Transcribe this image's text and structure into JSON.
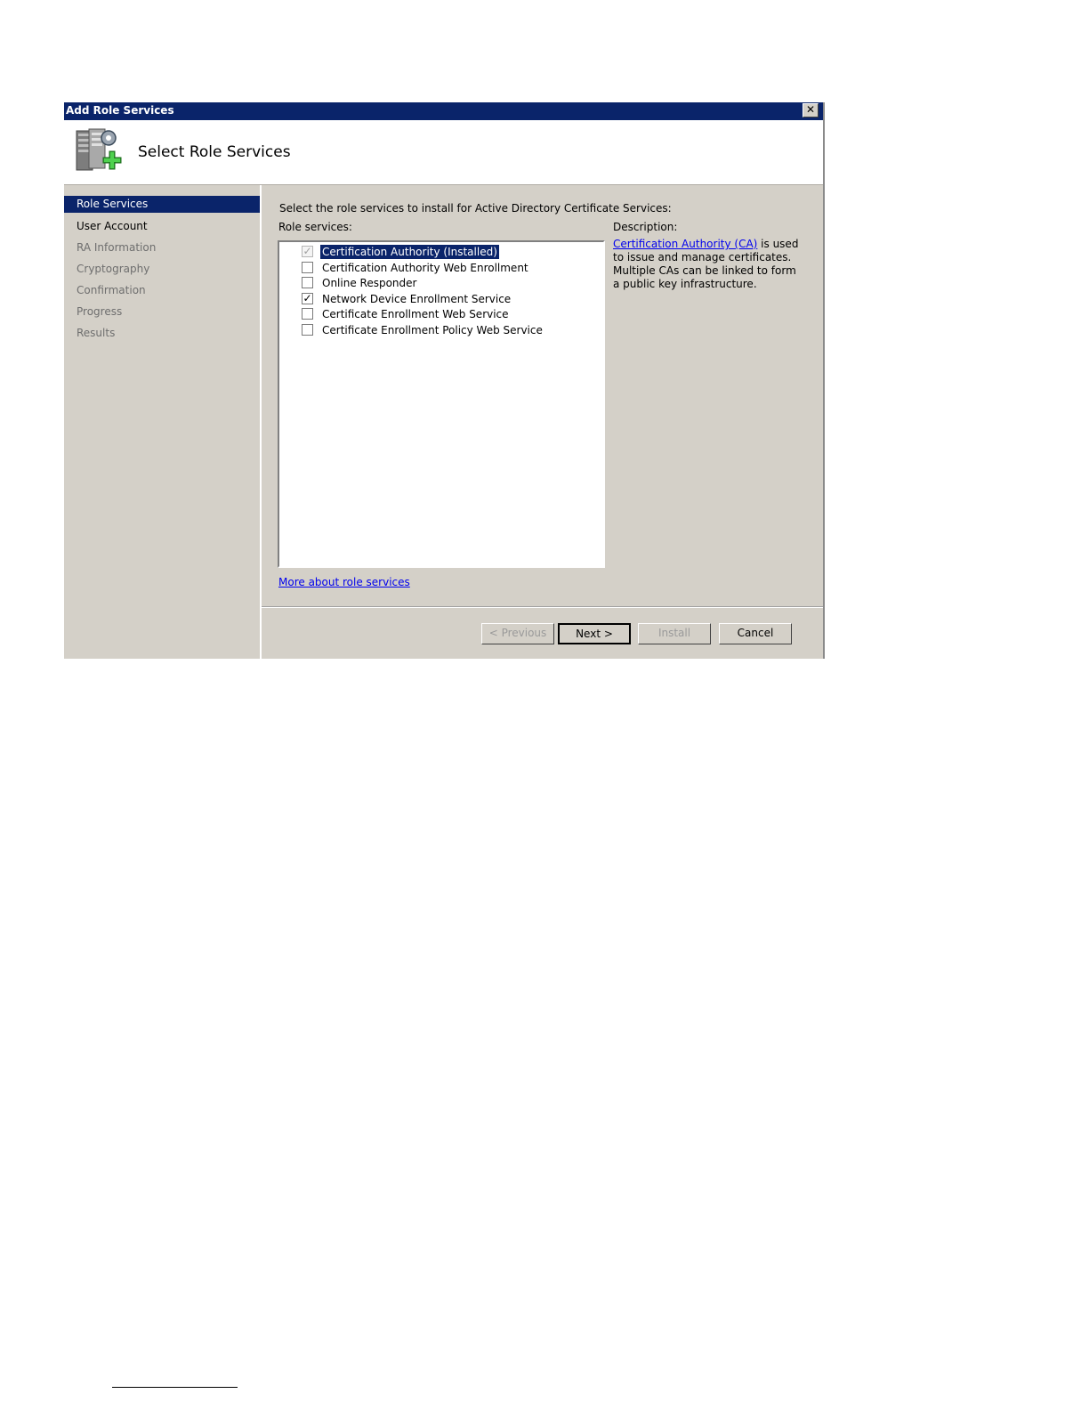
{
  "window": {
    "title": "Add Role Services",
    "close_glyph": "✕"
  },
  "header": {
    "title": "Select Role Services",
    "icon": "server-add-icon"
  },
  "nav": {
    "items": [
      {
        "label": "Role Services",
        "state": "active"
      },
      {
        "label": "User Account",
        "state": "normal"
      },
      {
        "label": "RA Information",
        "state": "disabled"
      },
      {
        "label": "Cryptography",
        "state": "disabled"
      },
      {
        "label": "Confirmation",
        "state": "disabled"
      },
      {
        "label": "Progress",
        "state": "disabled"
      },
      {
        "label": "Results",
        "state": "disabled"
      }
    ]
  },
  "main": {
    "instruction": "Select the role services to install for Active Directory Certificate Services:",
    "role_services_label": "Role services:",
    "role_services": [
      {
        "label": "Certification Authority  (Installed)",
        "checked": true,
        "disabled": true,
        "selected": true
      },
      {
        "label": "Certification Authority Web Enrollment",
        "checked": false
      },
      {
        "label": "Online Responder",
        "checked": false
      },
      {
        "label": "Network Device Enrollment Service",
        "checked": true
      },
      {
        "label": "Certificate Enrollment Web Service",
        "checked": false
      },
      {
        "label": "Certificate Enrollment Policy Web Service",
        "checked": false
      }
    ],
    "check_glyph": "✓",
    "description_label": "Description:",
    "description_link": "Certification Authority (CA)",
    "description_text": " is used to issue and manage certificates. Multiple CAs can be linked to form a public key infrastructure.",
    "more_link": "More about role services"
  },
  "buttons": {
    "previous": "< Previous",
    "next": "Next >",
    "install": "Install",
    "cancel": "Cancel"
  },
  "colors": {
    "titlebar": "#0a246a",
    "dialog_bg": "#d4d0c8",
    "link": "#0000ee"
  }
}
